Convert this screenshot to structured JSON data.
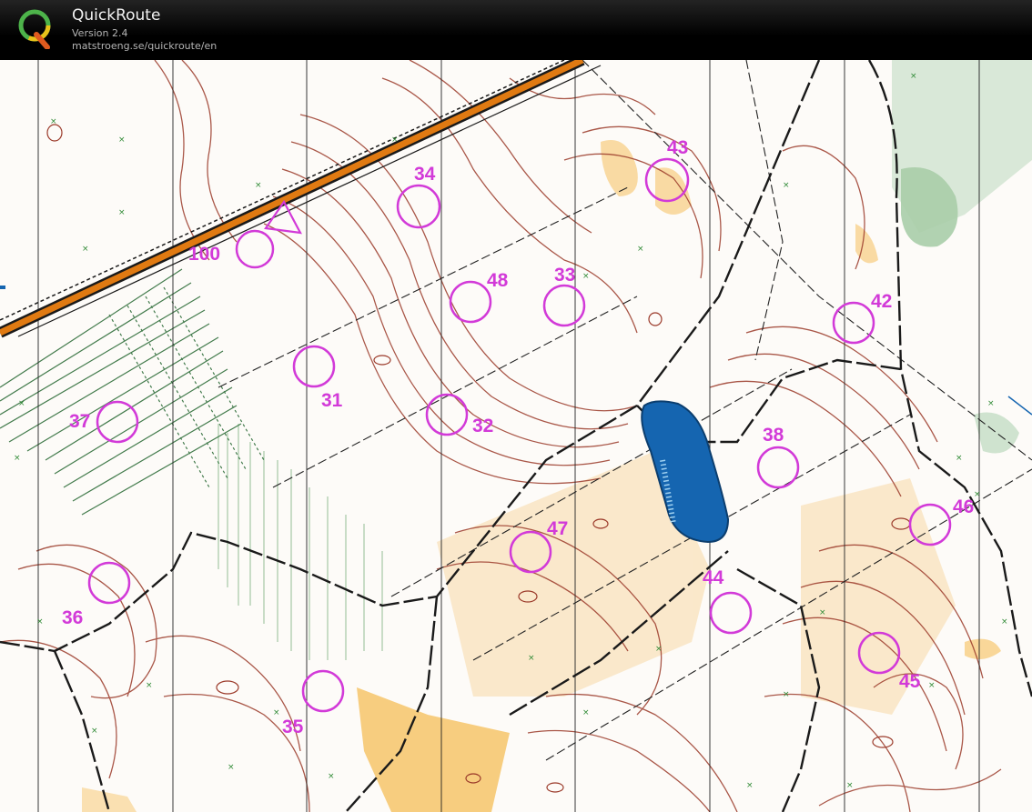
{
  "app": {
    "title": "QuickRoute",
    "version": "Version 2.4",
    "url": "matstroeng.se/quickroute/en"
  },
  "course": {
    "start_label": "100",
    "controls": [
      "34",
      "43",
      "48",
      "33",
      "42",
      "31",
      "32",
      "37",
      "38",
      "46",
      "47",
      "36",
      "44",
      "45",
      "35"
    ]
  },
  "colors": {
    "contour": "#9b3a2a",
    "course": "#d23ad8",
    "water": "#1565b0",
    "open_land": "#f6c56a",
    "vegetation": "#2f6e3a",
    "road": "#e07a12",
    "title_bar": "#000000"
  }
}
